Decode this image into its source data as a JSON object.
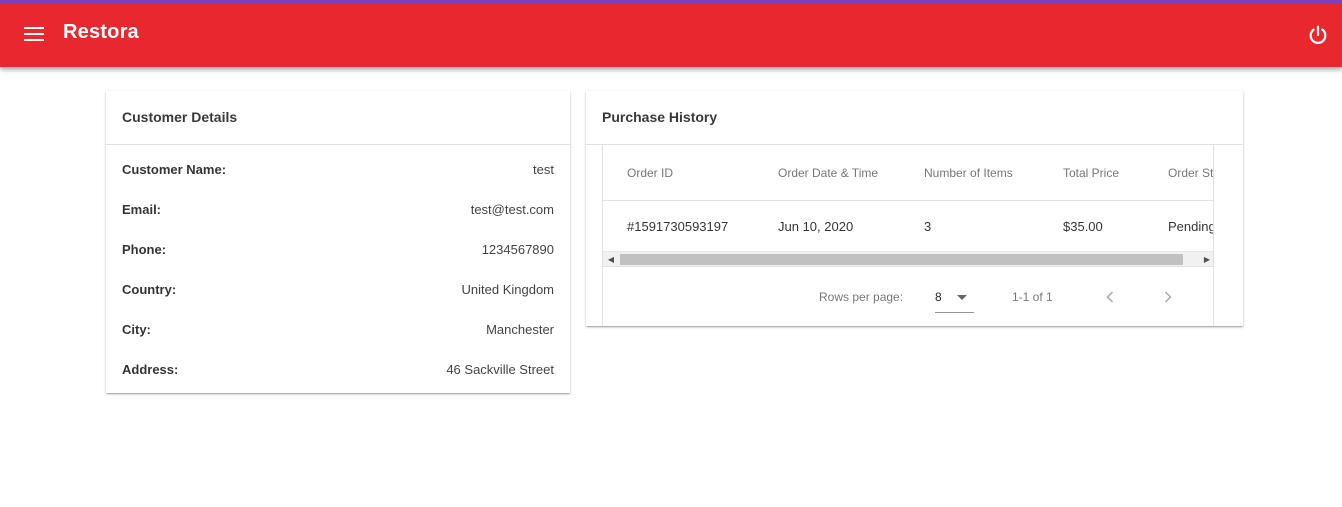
{
  "app": {
    "title": "Restora",
    "menu_icon": "menu-icon",
    "power_icon": "power-icon",
    "colors": {
      "appbar": "#e8272f",
      "accent_top": "#7b3fbf"
    }
  },
  "customer": {
    "header": "Customer Details",
    "fields": [
      {
        "label": "Customer Name:",
        "value": "test"
      },
      {
        "label": "Email:",
        "value": "test@test.com"
      },
      {
        "label": "Phone:",
        "value": "1234567890"
      },
      {
        "label": "Country:",
        "value": "United Kingdom"
      },
      {
        "label": "City:",
        "value": "Manchester"
      },
      {
        "label": "Address:",
        "value": "46 Sackville Street"
      }
    ]
  },
  "purchases": {
    "header": "Purchase History",
    "columns": [
      "Order ID",
      "Order Date & Time",
      "Number of Items",
      "Total Price",
      "Order Status"
    ],
    "rows": [
      [
        "#1591730593197",
        "Jun 10, 2020",
        "3",
        "$35.00",
        "Pending"
      ]
    ],
    "pagination": {
      "rows_per_page_label": "Rows per page:",
      "rows_per_page_value": "8",
      "range": "1-1 of 1",
      "prev_icon": "chevron-left-icon",
      "next_icon": "chevron-right-icon"
    }
  }
}
